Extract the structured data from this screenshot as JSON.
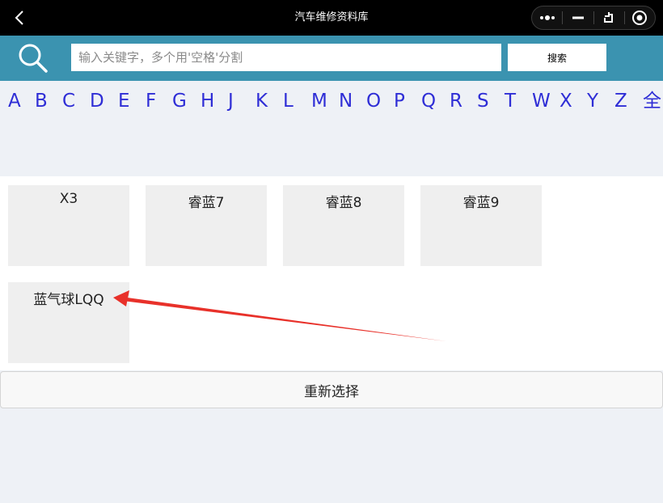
{
  "titlebar": {
    "title": "汽车维修资料库",
    "back_icon": "chevron-left-icon",
    "capsule_icons": [
      "more-dots-icon",
      "minimize-icon",
      "restore-icon",
      "record-icon"
    ]
  },
  "search": {
    "placeholder": "输入关键字，多个用'空格'分割",
    "value": "",
    "button_label": "搜索",
    "icon": "search-icon",
    "bar_color": "#3b93b0"
  },
  "letters": [
    "A",
    "B",
    "C",
    "D",
    "E",
    "F",
    "G",
    "H",
    "J",
    "K",
    "L",
    "M",
    "N",
    "O",
    "P",
    "Q",
    "R",
    "S",
    "T",
    "W",
    "X",
    "Y",
    "Z",
    "全"
  ],
  "letter_color": "#2f2ed6",
  "models": [
    {
      "label": "X3"
    },
    {
      "label": "睿蓝7"
    },
    {
      "label": "睿蓝8"
    },
    {
      "label": "睿蓝9"
    },
    {
      "label": "蓝气球LQQ"
    }
  ],
  "reset_label": "重新选择",
  "annotation_color": "#e8312a"
}
